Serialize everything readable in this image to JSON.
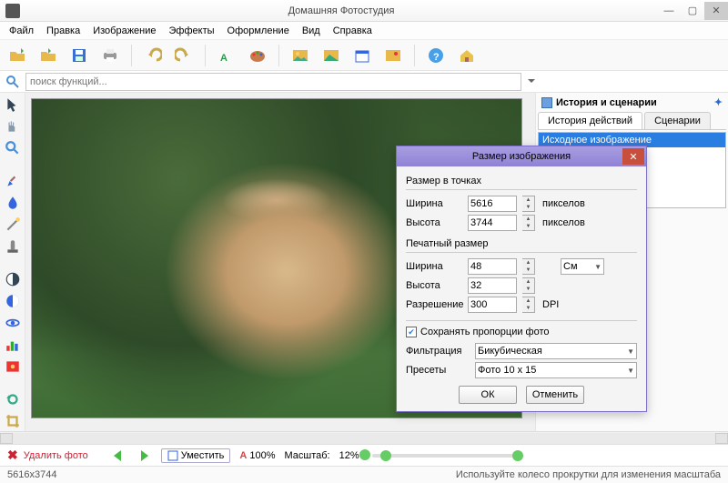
{
  "window": {
    "title": "Домашняя Фотостудия"
  },
  "menu": [
    "Файл",
    "Правка",
    "Изображение",
    "Эффекты",
    "Оформление",
    "Вид",
    "Справка"
  ],
  "search": {
    "placeholder": "поиск функций..."
  },
  "rightpanel": {
    "title": "История и сценарии",
    "tabs": [
      "История действий",
      "Сценарии"
    ],
    "history_item": "Исходное изображение"
  },
  "dialog": {
    "title": "Размер изображения",
    "section_px": "Размер в точках",
    "section_print": "Печатный размер",
    "width_lbl": "Ширина",
    "height_lbl": "Высота",
    "res_lbl": "Разрешение",
    "px_unit": "пикселов",
    "dpi_unit": "DPI",
    "cm_unit": "См",
    "width_px": "5616",
    "height_px": "3744",
    "width_cm": "48",
    "height_cm": "32",
    "dpi": "300",
    "keep_ratio": "Сохранять пропорции фото",
    "filter_lbl": "Фильтрация",
    "filter_val": "Бикубическая",
    "preset_lbl": "Пресеты",
    "preset_val": "Фото 10 x 15",
    "ok": "ОК",
    "cancel": "Отменить"
  },
  "bottom": {
    "delete": "Удалить фото",
    "fit": "Уместить",
    "zoom100": "100%",
    "scale_lbl": "Масштаб:",
    "scale_val": "12%"
  },
  "status": {
    "dims": "5616x3744",
    "hint": "Используйте колесо прокрутки для изменения масштаба"
  }
}
